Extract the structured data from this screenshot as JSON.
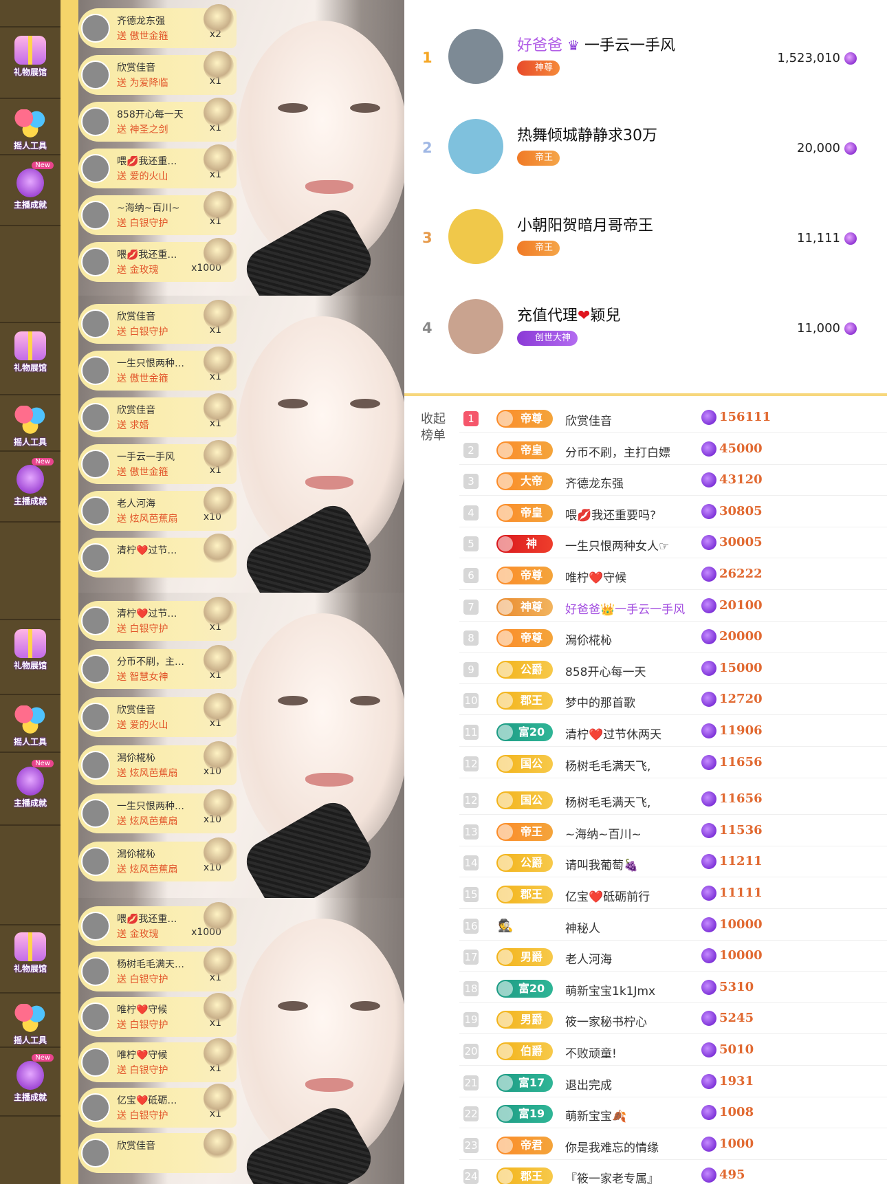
{
  "sidebar": {
    "gift_hall": "礼物展馆",
    "tool": "摇人工具",
    "achievement": "主播成就",
    "new_tag": "New"
  },
  "feeds": [
    [
      {
        "name": "齐德龙东强",
        "gift": "送 傲世金箍",
        "qty": "x2"
      },
      {
        "name": "欣赏佳音",
        "gift": "送 为爱降临",
        "qty": "x1"
      },
      {
        "name": "858开心每一天",
        "gift": "送 神圣之剑",
        "qty": "x1"
      },
      {
        "name": "喂💋我还重…",
        "gift": "送 爱的火山",
        "qty": "x1"
      },
      {
        "name": "~海纳~百川~",
        "gift": "送 白银守护",
        "qty": "x1"
      },
      {
        "name": "喂💋我还重…",
        "gift": "送 金玫瑰",
        "qty": "x1000"
      }
    ],
    [
      {
        "name": "欣赏佳音",
        "gift": "送 白银守护",
        "qty": "x1"
      },
      {
        "name": "一生只恨两种…",
        "gift": "送 傲世金箍",
        "qty": "x1"
      },
      {
        "name": "欣赏佳音",
        "gift": "送 求婚",
        "qty": "x1"
      },
      {
        "name": "一手云一手风",
        "gift": "送 傲世金箍",
        "qty": "x1"
      },
      {
        "name": "老人河海",
        "gift": "送 炫风芭蕉扇",
        "qty": "x10"
      },
      {
        "name": "清柠❤️过节…",
        "gift": "",
        "qty": ""
      }
    ],
    [
      {
        "name": "清柠❤️过节…",
        "gift": "送 白银守护",
        "qty": "x1"
      },
      {
        "name": "分币不刷，主…",
        "gift": "送 智慧女神",
        "qty": "x1"
      },
      {
        "name": "欣赏佳音",
        "gift": "送 爱的火山",
        "qty": "x1"
      },
      {
        "name": "澙伱椛杺",
        "gift": "送 炫风芭蕉扇",
        "qty": "x10"
      },
      {
        "name": "一生只恨两种…",
        "gift": "送 炫风芭蕉扇",
        "qty": "x10"
      },
      {
        "name": "澙伱椛杺",
        "gift": "送 炫风芭蕉扇",
        "qty": "x10"
      }
    ],
    [
      {
        "name": "喂💋我还重…",
        "gift": "送 金玫瑰",
        "qty": "x1000"
      },
      {
        "name": "杨树毛毛满天…",
        "gift": "送 白银守护",
        "qty": "x1"
      },
      {
        "name": "唯柠❤️守候",
        "gift": "送 白银守护",
        "qty": "x1"
      },
      {
        "name": "唯柠❤️守候",
        "gift": "送 白银守护",
        "qty": "x1"
      },
      {
        "name": "亿宝❤️砥砺…",
        "gift": "送 白银守护",
        "qty": "x1"
      },
      {
        "name": "欣赏佳音",
        "gift": "",
        "qty": ""
      }
    ]
  ],
  "top_rank": [
    {
      "rank": "1",
      "name_a": "好爸爸",
      "name_b": "一手云一手风",
      "badge": "神尊",
      "score": "1,523,010",
      "color": "#f5a623"
    },
    {
      "rank": "2",
      "name_a": "热舞倾城静静求30万",
      "name_b": "",
      "badge": "帝王",
      "score": "20,000",
      "color": "#9fb7e4"
    },
    {
      "rank": "3",
      "name_a": "小朝阳贺暗月哥帝王",
      "name_b": "",
      "badge": "帝王",
      "score": "11,111",
      "color": "#e69a4a"
    },
    {
      "rank": "4",
      "name_a": "充值代理",
      "name_b": "颖兒",
      "badge": "创世大神",
      "score": "11,000",
      "color": "#888888"
    }
  ],
  "list_panel": {
    "collapse_label": "收起榜单",
    "rows": [
      {
        "n": "1",
        "lv": "帝尊",
        "style": "orange",
        "name": "欣赏佳音",
        "score": "156111"
      },
      {
        "n": "2",
        "lv": "帝皇",
        "style": "orange",
        "name": "分币不刷，主打白嫖",
        "score": "45000"
      },
      {
        "n": "3",
        "lv": "大帝",
        "style": "orange",
        "name": "齐德龙东强",
        "score": "43120"
      },
      {
        "n": "4",
        "lv": "帝皇",
        "style": "orange",
        "name": "喂💋我还重要吗?",
        "score": "30805"
      },
      {
        "n": "5",
        "lv": "神",
        "style": "red",
        "name": "一生只恨两种女人☞",
        "score": "30005"
      },
      {
        "n": "6",
        "lv": "帝尊",
        "style": "orange",
        "name": "唯柠❤️守候",
        "score": "26222"
      },
      {
        "n": "7",
        "lv": "神尊",
        "style": "shen",
        "name": "好爸爸👑一手云一手风",
        "score": "20100",
        "purple": true
      },
      {
        "n": "8",
        "lv": "帝尊",
        "style": "orange",
        "name": "澙伱椛杺",
        "score": "20000"
      },
      {
        "n": "9",
        "lv": "公爵",
        "style": "gold",
        "name": "858开心每一天",
        "score": "15000"
      },
      {
        "n": "10",
        "lv": "郡王",
        "style": "gold",
        "name": "梦中的那首歌",
        "score": "12720"
      },
      {
        "n": "11",
        "lv": "富20",
        "style": "green",
        "name": "清柠❤️过节休两天",
        "score": "11906"
      },
      {
        "n": "12",
        "lv": "国公",
        "style": "gold",
        "name": "杨树毛毛满天飞,",
        "score": "11656"
      },
      {
        "n": "12",
        "lv": "国公",
        "style": "gold",
        "name": "杨树毛毛满天飞,",
        "score": "11656"
      },
      {
        "n": "13",
        "lv": "帝王",
        "style": "orange",
        "name": "~海纳~百川~",
        "score": "11536"
      },
      {
        "n": "14",
        "lv": "公爵",
        "style": "gold",
        "name": "请叫我葡萄🍇",
        "score": "11211"
      },
      {
        "n": "15",
        "lv": "郡王",
        "style": "gold",
        "name": "亿宝❤️砥砺前行",
        "score": "11111"
      },
      {
        "n": "16",
        "lv": "",
        "style": "none",
        "name": "神秘人",
        "score": "10000",
        "mystery": true
      },
      {
        "n": "17",
        "lv": "男爵",
        "style": "gold",
        "name": "老人河海",
        "score": "10000"
      },
      {
        "n": "18",
        "lv": "富20",
        "style": "green",
        "name": "萌新宝宝1k1Jmx",
        "score": "5310"
      },
      {
        "n": "19",
        "lv": "男爵",
        "style": "gold",
        "name": "筱一家秘书柠心",
        "score": "5245"
      },
      {
        "n": "20",
        "lv": "伯爵",
        "style": "gold",
        "name": "不败顽童!",
        "score": "5010"
      },
      {
        "n": "21",
        "lv": "富17",
        "style": "green",
        "name": "退出完成",
        "score": "1931"
      },
      {
        "n": "22",
        "lv": "富19",
        "style": "green",
        "name": "萌新宝宝🍂",
        "score": "1008"
      },
      {
        "n": "23",
        "lv": "帝君",
        "style": "orange",
        "name": "你是我难忘的情缘",
        "score": "1000"
      },
      {
        "n": "24",
        "lv": "郡王",
        "style": "gold",
        "name": "『筱一家老专属』",
        "score": "495"
      }
    ]
  }
}
